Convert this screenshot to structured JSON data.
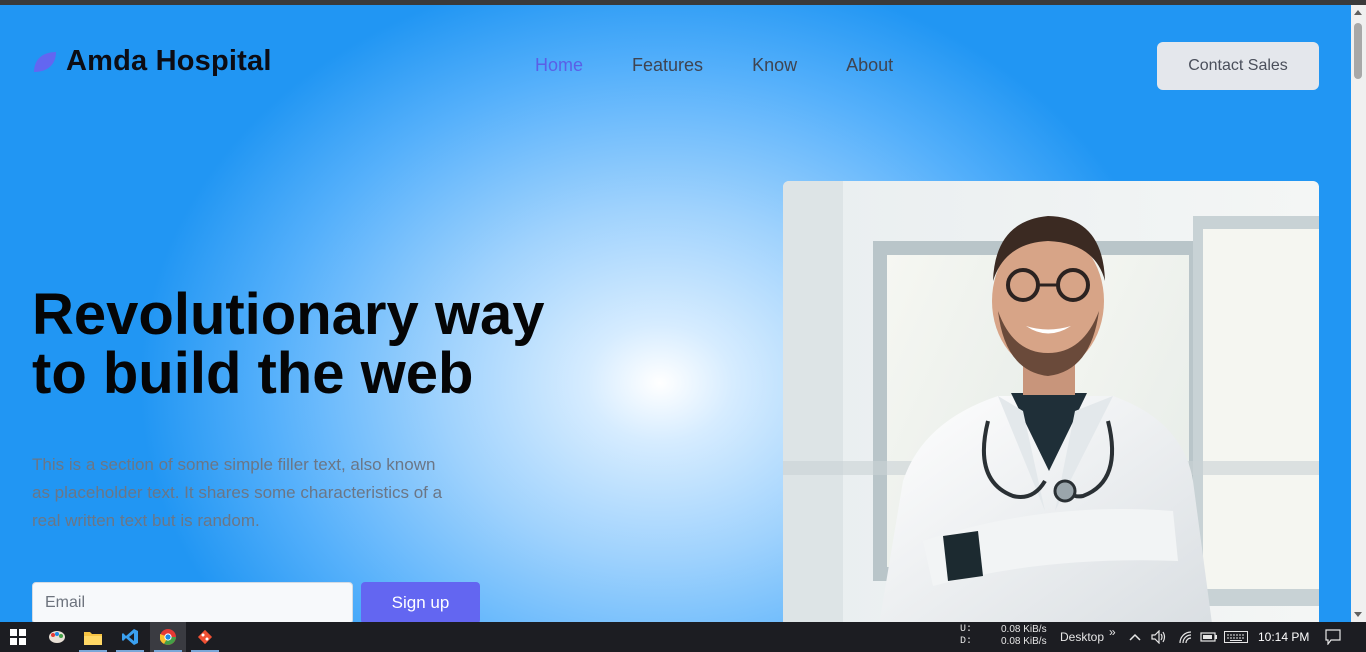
{
  "header": {
    "brand": "Amda Hospital",
    "nav": [
      {
        "label": "Home",
        "active": true
      },
      {
        "label": "Features",
        "active": false
      },
      {
        "label": "Know",
        "active": false
      },
      {
        "label": "About",
        "active": false
      }
    ],
    "contact_label": "Contact Sales"
  },
  "hero": {
    "title_line1": "Revolutionary way",
    "title_line2": "to build the web",
    "text_line1": "This is a section of some simple filler text, also known",
    "text_line2": "as placeholder text. It shares some characteristics of a",
    "text_line3": "real written text but is random.",
    "email_placeholder": "Email",
    "signup_label": "Sign up"
  },
  "colors": {
    "accent": "#6366f1",
    "nav_active": "#5b5fe6",
    "background_edge": "#2196f3",
    "background_center": "#ffffff"
  },
  "taskbar": {
    "icons": [
      "windows-start-icon",
      "paint-app-icon",
      "file-explorer-icon",
      "vscode-icon",
      "chrome-icon",
      "git-icon"
    ],
    "net_up_label": "U:",
    "net_down_label": "D:",
    "net_up": "0.08 KiB/s",
    "net_down": "0.08 KiB/s",
    "desktop": "Desktop",
    "chevron": "»",
    "time": "10:14 PM"
  }
}
